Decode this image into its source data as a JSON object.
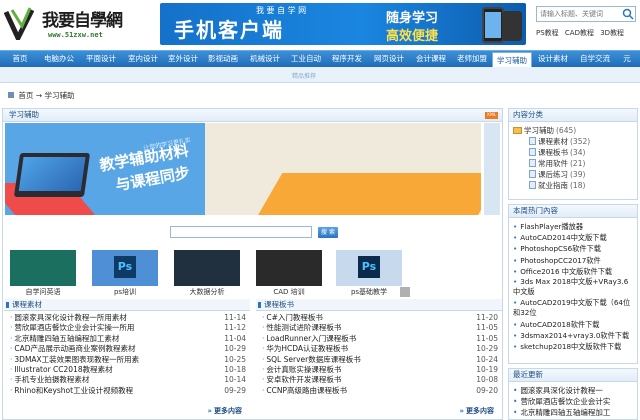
{
  "logo": {
    "name": "我要自學網",
    "url": "www.51zxw.net"
  },
  "banner": {
    "sub": "我 要 自 学 网",
    "main": "手机客户端",
    "tag1": "随身学习",
    "tag2": "高效便捷"
  },
  "search": {
    "placeholder": "请输入标题、关键词"
  },
  "quick_links": [
    "PS教程",
    "CAD教程",
    "3D教程"
  ],
  "nav": [
    "首页",
    "电脑办公",
    "平面设计",
    "室内设计",
    "室外设计",
    "影视动画",
    "机械设计",
    "工业自动",
    "程序开发",
    "网页设计",
    "会计课程",
    "老师加盟",
    "学习辅助",
    "设计素材",
    "自学交流",
    "元"
  ],
  "nav_active": "学习辅助",
  "subnav_hint": "精品推荐",
  "breadcrumb": {
    "home": "首页",
    "sep": "→",
    "current": "学习辅助"
  },
  "main": {
    "title": "学习辅助",
    "xml": "XML",
    "hero": {
      "h1": "教学辅助材料",
      "h2": "与课程同步",
      "tag": "让您的学习更扎实"
    },
    "search_button": "搜 索"
  },
  "thumbs": [
    {
      "caption": "自学问英语",
      "color": "#1b6f5e"
    },
    {
      "caption": "ps培训",
      "color": "#4f8fd6"
    },
    {
      "caption": "大数据分析",
      "color": "#20303f"
    },
    {
      "caption": "CAD 培训",
      "color": "#2a2a2a"
    },
    {
      "caption": "ps基础教学",
      "color": "#c7d9ec"
    }
  ],
  "materials": {
    "title": "课程素材",
    "more": "更多内容",
    "items": [
      {
        "title": "圆滚家具深化设计教程一所用素材",
        "date": "11-14"
      },
      {
        "title": "营欣犀酒店餐饮企业会计实操一所用",
        "date": "11-12"
      },
      {
        "title": "北京精雕四轴五轴编程加工素材",
        "date": "11-04"
      },
      {
        "title": "CAD产品展示动画商业案例教程素材",
        "date": "10-29"
      },
      {
        "title": "3DMAX工装效果图表现教程一所用素",
        "date": "10-25"
      },
      {
        "title": "Illustrator CC2018教程素材",
        "date": "10-18"
      },
      {
        "title": "手机专业拍摄教程素材",
        "date": "10-14"
      },
      {
        "title": "Rhino和Keyshot工业设计视频教程",
        "date": "09-29"
      }
    ]
  },
  "board": {
    "title": "课程板书",
    "more": "更多内容",
    "items": [
      {
        "title": "C#入门教程板书",
        "date": "11-20"
      },
      {
        "title": "性能测试进阶课程板书",
        "date": "11-05"
      },
      {
        "title": "LoadRunner入门课程板书",
        "date": "11-05"
      },
      {
        "title": "华为HCDA认证教程板书",
        "date": "10-29"
      },
      {
        "title": "SQL Server数据库课程板书",
        "date": "10-24"
      },
      {
        "title": "会计真账实操课程板书",
        "date": "10-19"
      },
      {
        "title": "安卓软件开发课程板书",
        "date": "10-08"
      },
      {
        "title": "CCNP高级路由课程板书",
        "date": "09-20"
      }
    ]
  },
  "category": {
    "title": "内容分类",
    "root": {
      "label": "学习辅助",
      "count": "(645)"
    },
    "items": [
      {
        "label": "课程素材",
        "count": "(352)"
      },
      {
        "label": "课程板书",
        "count": "(34)"
      },
      {
        "label": "常用软件",
        "count": "(21)"
      },
      {
        "label": "课后练习",
        "count": "(39)"
      },
      {
        "label": "就业指南",
        "count": "(18)"
      }
    ]
  },
  "hot": {
    "title": "本周热门內容",
    "items": [
      "FlashPlayer播放器",
      "AutoCAD2014中文版下载",
      "PhotoshopCS6软件下载",
      "PhotoshopCC2017软件",
      "Office2016 中文版软件下载",
      "3ds Max 2018中文版+VRay3.6中文版",
      "AutoCAD2019中文版下载（64位和32位",
      "AutoCAD2018软件下载",
      "3dsmax2014+vray3.0软件下载",
      "sketchup2018中文版软件下载"
    ]
  },
  "latest": {
    "title": "最近更新",
    "items": [
      "圆滚家具深化设计教程一",
      "营欣犀酒店餐饮企业会计实",
      "北京精雕四轴五轴编程加工"
    ]
  }
}
